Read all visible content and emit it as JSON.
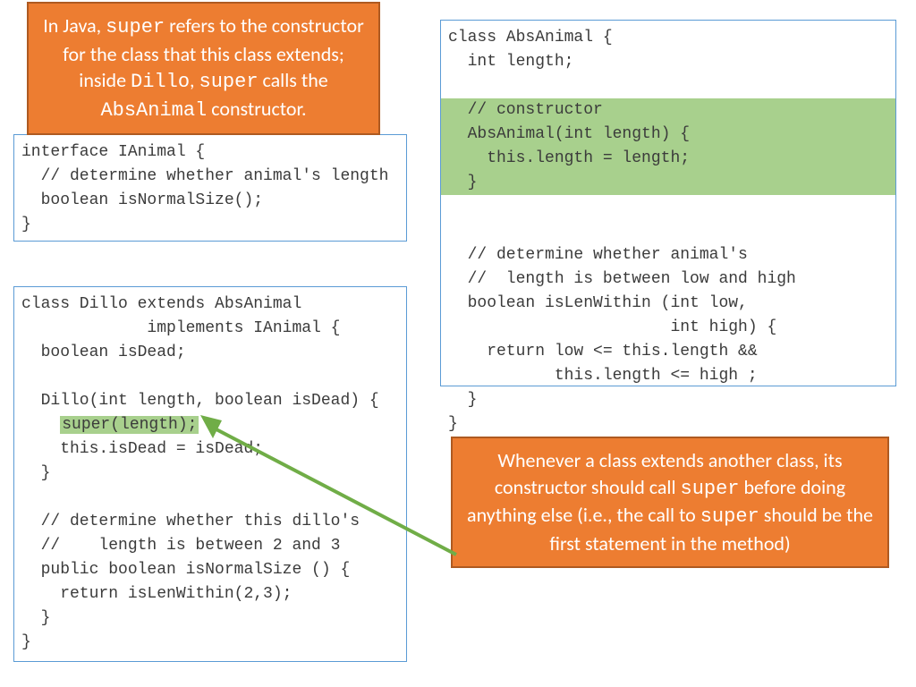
{
  "callouts": {
    "top": {
      "p1": "In Java, ",
      "c1": "super",
      "p2": " refers to the constructor for the class that this class extends; inside ",
      "c2": "Dillo",
      "p3": ", ",
      "c3": "super",
      "p4": " calls the ",
      "c4": "AbsAnimal",
      "p5": " constructor."
    },
    "bottom": {
      "p1": "Whenever a class extends another class, its constructor should call ",
      "c1": "super",
      "p2": " before doing anything else (i.e., the call to ",
      "c2": "super",
      "p3": " should be the first statement in the method)"
    }
  },
  "code": {
    "interface": {
      "pre": "interface IAnimal {\n  // determine whether animal's length\n  boolean isNormalSize();\n}"
    },
    "dillo": {
      "l1": "class Dillo extends AbsAnimal",
      "l2": "             implements IAnimal {",
      "l3": "  boolean isDead;",
      "l4": "",
      "l5": "  Dillo(int length, boolean isDead) {",
      "l6a": "    ",
      "l6hl": "super(length);",
      "l7": "    this.isDead = isDead;",
      "l8": "  }",
      "l9": "",
      "l10": "  // determine whether this dillo's",
      "l11": "  //    length is between 2 and 3",
      "l12": "  public boolean isNormalSize () {",
      "l13": "    return isLenWithin(2,3);",
      "l14": "  }",
      "l15": "}"
    },
    "absanimal": {
      "l1": "class AbsAnimal {",
      "l2": "  int length;",
      "l3": "",
      "hl1": "  // constructor",
      "hl2": "  AbsAnimal(int length) {",
      "hl3": "    this.length = length;",
      "hl4": "  }",
      "l8": "",
      "l9": "  // determine whether animal's",
      "l10": "  //  length is between low and high",
      "l11": "  boolean isLenWithin (int low,",
      "l12": "                       int high) {",
      "l13": "    return low <= this.length &&",
      "l14": "           this.length <= high ;",
      "l15": "  }",
      "l16": "}"
    }
  }
}
